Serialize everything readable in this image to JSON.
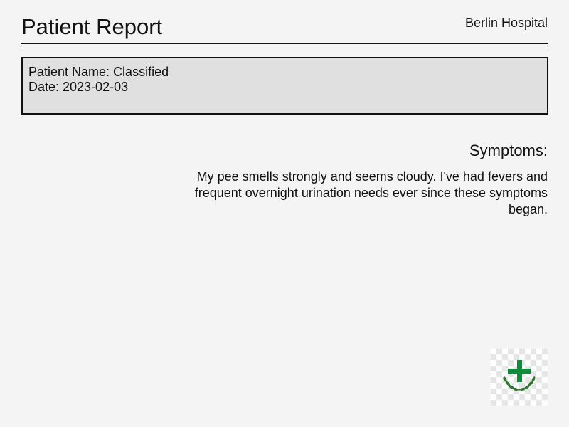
{
  "header": {
    "title": "Patient Report",
    "hospital": "Berlin Hospital"
  },
  "patient_info": {
    "name_line": "Patient Name: Classified",
    "date_line": "Date: 2023-02-03"
  },
  "symptoms": {
    "heading": "Symptoms:",
    "text": "My pee smells strongly and seems cloudy. I've had fevers and frequent overnight urination needs ever since these symptoms began."
  },
  "colors": {
    "logo_green": "#118a3e",
    "logo_leaf_green": "#2f7a2f"
  },
  "icons": {
    "logo": "medical-cross-laurel-icon"
  }
}
